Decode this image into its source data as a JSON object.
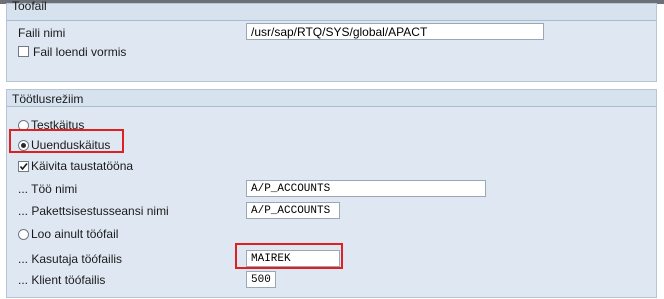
{
  "group_file": {
    "title": "Toofail",
    "faili_nimi_label": "Faili nimi",
    "faili_nimi_value": "/usr/sap/RTQ/SYS/global/APACT",
    "fail_loendi_vormis_label": "Fail loendi vormis"
  },
  "group_mode": {
    "title": "Töötlusrežiim",
    "testkaitus_label": "Testkäitus",
    "uuenduskaitus_label": "Uuenduskäitus",
    "kaivita_label": "Käivita taustatööna",
    "too_nimi_label": "... Töö nimi",
    "too_nimi_value": "A/P_ACCOUNTS",
    "pakett_label": "... Pakettsisestusseansi nimi",
    "pakett_value": "A/P_ACCOUNTS",
    "loo_ainult_label": "Loo ainult töófail",
    "kasutaja_label": "... Kasutaja töófailis",
    "kasutaja_value": "MAIREK",
    "klient_label": "... Klient töófailis",
    "klient_value": "500"
  },
  "colors": {
    "panel_bg": "#dfe8f2",
    "highlight": "#e02020"
  }
}
